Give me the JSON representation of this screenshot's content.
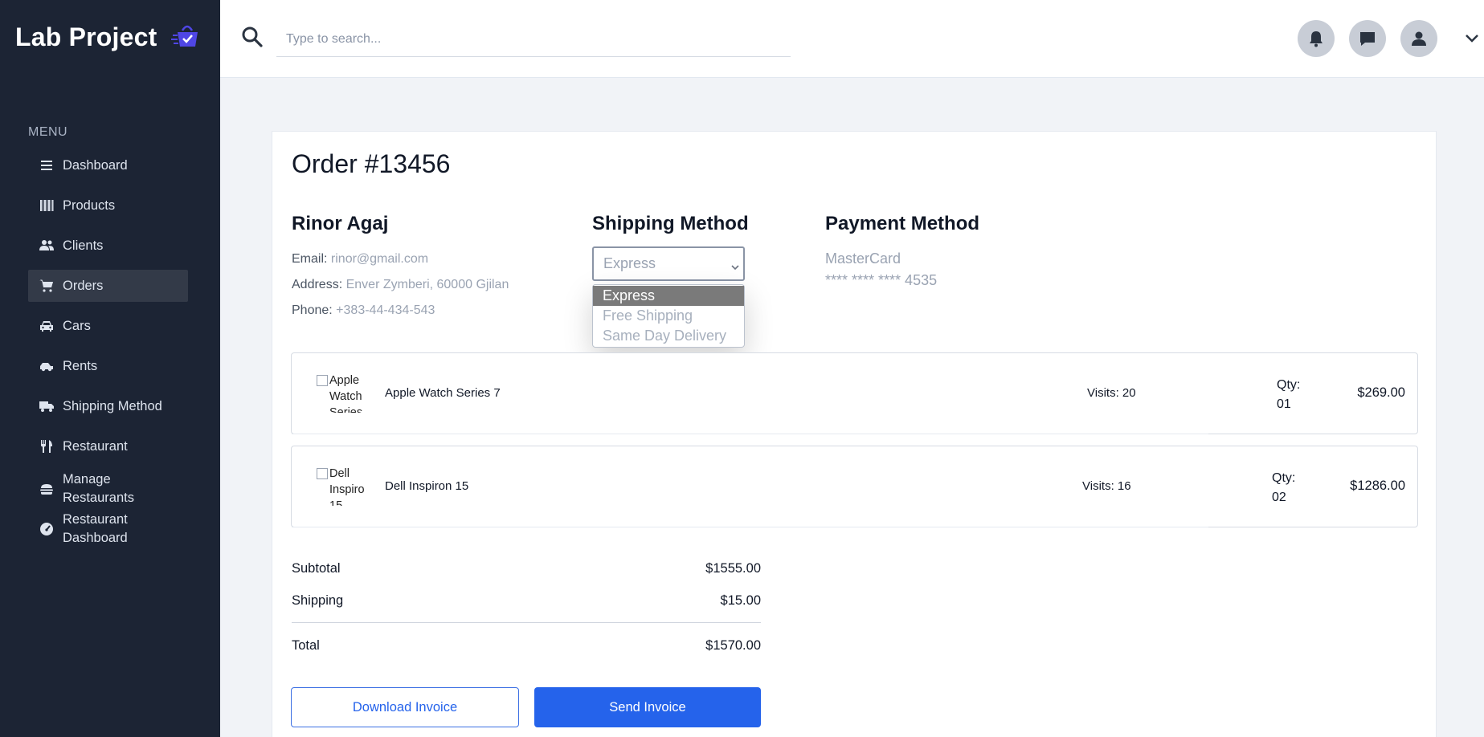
{
  "brand": {
    "title": "Lab Project",
    "logo_icon": "shopping-basket-logo-icon",
    "accent": "#4f46e5"
  },
  "sidebar": {
    "menu_heading": "MENU",
    "items": [
      {
        "label": "Dashboard",
        "icon": "menu-icon"
      },
      {
        "label": "Products",
        "icon": "barcode-icon"
      },
      {
        "label": "Clients",
        "icon": "users-icon"
      },
      {
        "label": "Orders",
        "icon": "cart-icon",
        "active": true
      },
      {
        "label": "Cars",
        "icon": "car-icon"
      },
      {
        "label": "Rents",
        "icon": "car-side-icon"
      },
      {
        "label": "Shipping Method",
        "icon": "truck-icon"
      },
      {
        "label": "Restaurant",
        "icon": "utensils-icon"
      },
      {
        "label": "Manage Restaurants",
        "icon": "burger-icon"
      },
      {
        "label": "Restaurant Dashboard",
        "icon": "gauge-icon"
      }
    ]
  },
  "header": {
    "search_placeholder": "Type to search...",
    "icons": [
      "notification-bell-icon",
      "chat-icon",
      "user-avatar-icon",
      "chevron-down-icon"
    ]
  },
  "order": {
    "title": "Order #13456",
    "customer": {
      "name": "Rinor Agaj",
      "email_label": "Email:",
      "email": "rinor@gmail.com",
      "address_label": "Address:",
      "address": "Enver Zymberi, 60000 Gjilan",
      "phone_label": "Phone:",
      "phone": "+383-44-434-543"
    },
    "shipping": {
      "heading": "Shipping Method",
      "selected": "Express",
      "options": [
        "Express",
        "Free Shipping",
        "Same Day Delivery"
      ]
    },
    "payment": {
      "heading": "Payment Method",
      "card_name": "MasterCard",
      "card_number": "**** **** **** 4535"
    },
    "items": [
      {
        "image_alt": "Apple Watch Series 7",
        "name": "Apple Watch Series 7",
        "visits": "Visits: 20",
        "qty_label": "Qty:",
        "qty": "01",
        "price": "$269.00"
      },
      {
        "image_alt": "Dell Inspiron 15",
        "name": "Dell Inspiron 15",
        "visits": "Visits: 16",
        "qty_label": "Qty:",
        "qty": "02",
        "price": "$1286.00"
      }
    ],
    "totals": {
      "subtotal_label": "Subtotal",
      "subtotal": "$1555.00",
      "shipping_label": "Shipping",
      "shipping": "$15.00",
      "total_label": "Total",
      "total": "$1570.00"
    },
    "actions": {
      "download": "Download Invoice",
      "send": "Send Invoice"
    }
  }
}
